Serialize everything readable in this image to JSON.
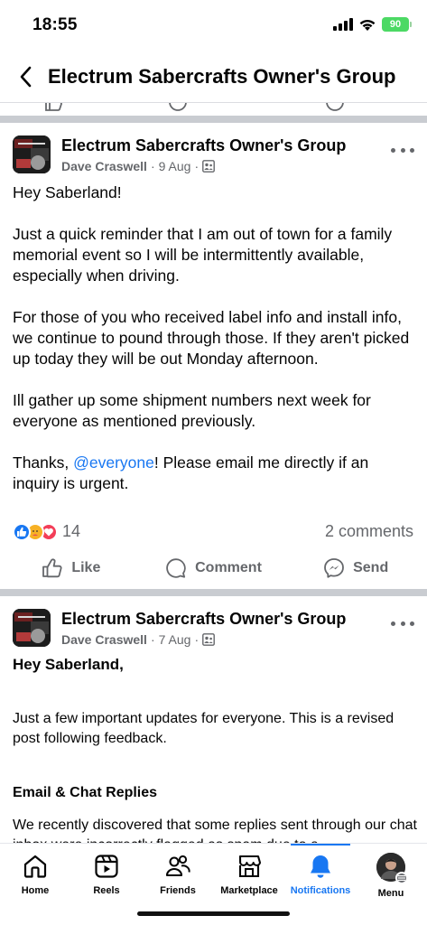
{
  "status_bar": {
    "time": "18:55",
    "battery": "90"
  },
  "header": {
    "title": "Electrum Sabercrafts Owner's Group"
  },
  "post1": {
    "group_name": "Electrum Sabercrafts Owner's Group",
    "author": "Dave Craswell",
    "date": "9 Aug",
    "sep": "·",
    "greeting": "Hey Saberland!",
    "para1": "Just a quick reminder that I am out of town for a family memorial event so I will be intermittently available, especially when driving.",
    "para2": "For those of you who received label info and install info, we continue to pound through those. If they aren't picked up today they will be out Monday afternoon.",
    "para3": "Ill gather up some shipment numbers next week for everyone as mentioned previously.",
    "para4_before": "Thanks, ",
    "mention": "@everyone",
    "para4_after": "! Please email me directly if an inquiry is urgent.",
    "reaction_count": "14",
    "comments": "2 comments",
    "actions": {
      "like": "Like",
      "comment": "Comment",
      "send": "Send"
    }
  },
  "post2": {
    "group_name": "Electrum Sabercrafts Owner's Group",
    "author": "Dave Craswell",
    "date": "7 Aug",
    "sep": "·",
    "greeting": "Hey Saberland,",
    "para1": "Just a few important updates for everyone. This is a revised post following feedback.",
    "section_heading": "Email & Chat Replies",
    "para2": "We recently discovered that some replies sent through our chat inbox were incorrectly flagged as spam due to a"
  },
  "bottom_nav": {
    "items": [
      {
        "label": "Home",
        "icon": "home-icon"
      },
      {
        "label": "Reels",
        "icon": "reels-icon"
      },
      {
        "label": "Friends",
        "icon": "friends-icon"
      },
      {
        "label": "Marketplace",
        "icon": "marketplace-icon"
      },
      {
        "label": "Notifications",
        "icon": "bell-icon"
      },
      {
        "label": "Menu",
        "icon": "profile-avatar"
      }
    ],
    "active": "Notifications",
    "accent": "#1877f2"
  }
}
